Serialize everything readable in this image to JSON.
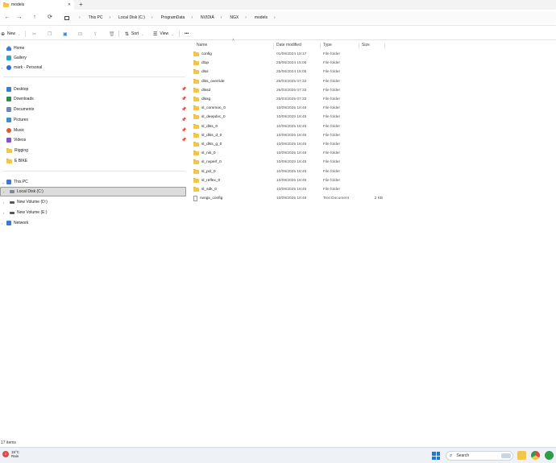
{
  "window": {
    "tab_title": "models",
    "tab_close": "✕",
    "new_tab": "+"
  },
  "nav": {
    "back": "←",
    "forward": "→",
    "up": "↑",
    "refresh": "⟳",
    "breadcrumbs": [
      "This PC",
      "Local Disk (C:)",
      "ProgramData",
      "NVIDIA",
      "NGX",
      "models"
    ],
    "separator": "›"
  },
  "toolbar": {
    "new_label": "New",
    "sort_label": "Sort",
    "view_label": "View",
    "more_label": "•••"
  },
  "sidebar": {
    "home": "Home",
    "gallery": "Gallery",
    "onedrive": "mark - Personal",
    "quick_access": [
      {
        "label": "Desktop",
        "icon": "desktop-icon",
        "color": "#3a7bd5"
      },
      {
        "label": "Downloads",
        "icon": "downloads-icon",
        "color": "#2e8b57"
      },
      {
        "label": "Documents",
        "icon": "documents-icon",
        "color": "#6b8cae"
      },
      {
        "label": "Pictures",
        "icon": "pictures-icon",
        "color": "#3a8fd5"
      },
      {
        "label": "Music",
        "icon": "music-icon",
        "color": "#e05a2a"
      },
      {
        "label": "Videos",
        "icon": "videos-icon",
        "color": "#8a4fd6"
      },
      {
        "label": "Rigging",
        "icon": "folder-icon",
        "color": "#f2c54b"
      },
      {
        "label": "E BIKE",
        "icon": "folder-icon",
        "color": "#f2c54b"
      }
    ],
    "this_pc": "This PC",
    "drives": [
      {
        "label": "Local Disk (C:)"
      },
      {
        "label": "New Volume (D:)"
      },
      {
        "label": "New Volume (E:)"
      }
    ],
    "network": "Network"
  },
  "columns": {
    "name": "Name",
    "date": "Date modified",
    "type": "Type",
    "size": "Size"
  },
  "files": [
    {
      "name": "config",
      "date": "01/09/2024 19:17",
      "type": "File folder",
      "size": "",
      "kind": "folder"
    },
    {
      "name": "dlop",
      "date": "25/06/2024 15:06",
      "type": "File folder",
      "size": "",
      "kind": "folder"
    },
    {
      "name": "dlss",
      "date": "25/06/2024 15:05",
      "type": "File folder",
      "size": "",
      "kind": "folder"
    },
    {
      "name": "dlss_override",
      "date": "26/03/2025 07:33",
      "type": "File folder",
      "size": "",
      "kind": "folder"
    },
    {
      "name": "dlssd",
      "date": "26/03/2025 07:33",
      "type": "File folder",
      "size": "",
      "kind": "folder"
    },
    {
      "name": "dlssg",
      "date": "26/03/2025 07:33",
      "type": "File folder",
      "size": "",
      "kind": "folder"
    },
    {
      "name": "sl_common_0",
      "date": "10/09/2025 18:45",
      "type": "File folder",
      "size": "",
      "kind": "folder"
    },
    {
      "name": "sl_deepdvc_0",
      "date": "10/09/2025 18:45",
      "type": "File folder",
      "size": "",
      "kind": "folder"
    },
    {
      "name": "sl_dlss_0",
      "date": "10/09/2025 18:45",
      "type": "File folder",
      "size": "",
      "kind": "folder"
    },
    {
      "name": "sl_dlss_d_0",
      "date": "10/09/2025 18:45",
      "type": "File folder",
      "size": "",
      "kind": "folder"
    },
    {
      "name": "sl_dlss_g_0",
      "date": "10/09/2025 18:45",
      "type": "File folder",
      "size": "",
      "kind": "folder"
    },
    {
      "name": "sl_nis_0",
      "date": "10/09/2025 18:45",
      "type": "File folder",
      "size": "",
      "kind": "folder"
    },
    {
      "name": "sl_nvperf_0",
      "date": "10/09/2025 18:45",
      "type": "File folder",
      "size": "",
      "kind": "folder"
    },
    {
      "name": "sl_pcl_0",
      "date": "10/09/2025 18:45",
      "type": "File folder",
      "size": "",
      "kind": "folder"
    },
    {
      "name": "sl_reflex_0",
      "date": "10/09/2025 18:45",
      "type": "File folder",
      "size": "",
      "kind": "folder"
    },
    {
      "name": "sl_sdk_0",
      "date": "10/09/2025 18:45",
      "type": "File folder",
      "size": "",
      "kind": "folder"
    },
    {
      "name": "nvngx_config",
      "date": "10/09/2025 18:45",
      "type": "Text Document",
      "size": "2 KB",
      "kind": "file"
    }
  ],
  "status": {
    "item_count": "17 items"
  },
  "taskbar": {
    "weather_badge": "1",
    "temperature": "15°C",
    "condition": "Rain",
    "search_placeholder": "Search"
  }
}
